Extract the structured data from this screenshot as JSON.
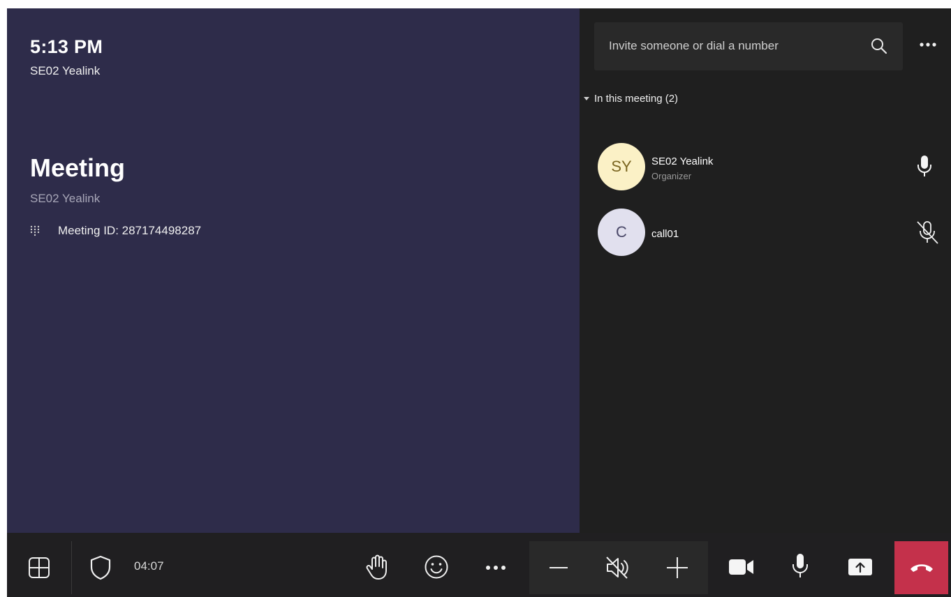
{
  "stage": {
    "time": "5:13 PM",
    "device_name": "SE02 Yealink",
    "meeting_title": "Meeting",
    "meeting_organizer": "SE02 Yealink",
    "meeting_id": "Meeting ID: 287174498287"
  },
  "panel": {
    "search_placeholder": "Invite someone or dial a number",
    "section_label": "In this meeting (2)",
    "participants": [
      {
        "initials": "SY",
        "name": "SE02 Yealink",
        "role": "Organizer",
        "mic": "mic-on",
        "avatar_bg": "#fbf1c6",
        "avatar_fg": "#7a6520"
      },
      {
        "initials": "C",
        "name": "call01",
        "role": "",
        "mic": "mic-muted",
        "avatar_bg": "#e1e0ee",
        "avatar_fg": "#4a4868"
      }
    ]
  },
  "toolbar": {
    "timer": "04:07",
    "icons": [
      "layout-icon",
      "shield-icon",
      "raise-hand-icon",
      "reactions-icon",
      "more-options-icon",
      "volume-down-icon",
      "speaker-muted-icon",
      "volume-up-icon",
      "camera-icon",
      "microphone-icon",
      "share-screen-icon",
      "hang-up-icon"
    ]
  },
  "colors": {
    "stage_bg": "#2e2c4a",
    "panel_bg": "#1f1f1f",
    "toolbar_bg": "#201f21",
    "hangup": "#c4314b"
  }
}
